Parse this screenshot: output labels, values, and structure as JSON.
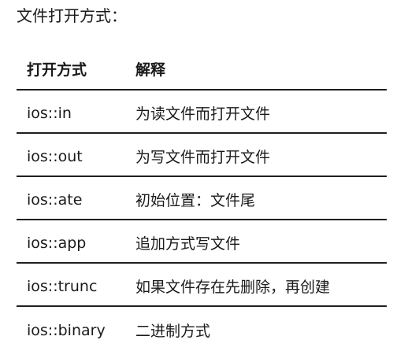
{
  "heading": "文件打开方式：",
  "table": {
    "headers": {
      "mode": "打开方式",
      "description": "解释"
    },
    "rows": [
      {
        "mode": "ios::in",
        "description": "为读文件而打开文件"
      },
      {
        "mode": "ios::out",
        "description": "为写文件而打开文件"
      },
      {
        "mode": "ios::ate",
        "description": "初始位置：文件尾"
      },
      {
        "mode": "ios::app",
        "description": "追加方式写文件"
      },
      {
        "mode": "ios::trunc",
        "description": "如果文件存在先删除，再创建"
      },
      {
        "mode": "ios::binary",
        "description": "二进制方式"
      }
    ]
  }
}
